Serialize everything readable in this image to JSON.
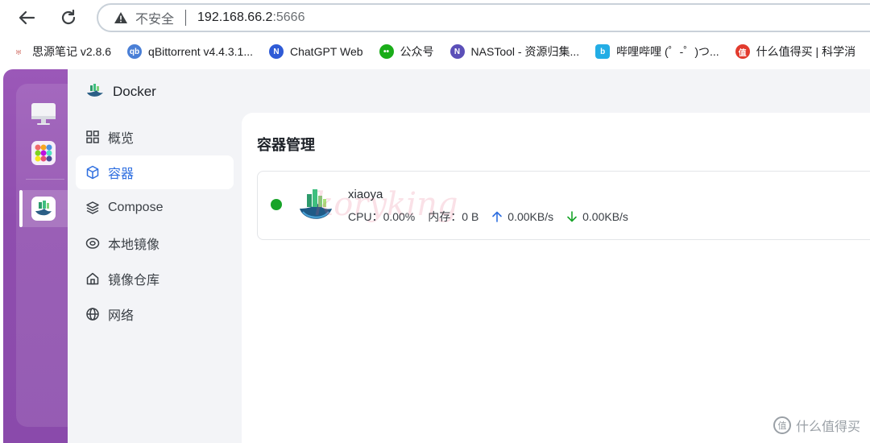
{
  "browser": {
    "security_label": "不安全",
    "url_host": "192.168.66.2",
    "url_port": ":5666"
  },
  "bookmarks": [
    {
      "label": "思源笔记 v2.8.6",
      "icon": "siyuan-icon",
      "color": "#c0392b",
      "glyph": "M"
    },
    {
      "label": "qBittorrent v4.4.3.1...",
      "icon": "qbittorrent-icon",
      "color": "#4a7fd6",
      "glyph": "qb"
    },
    {
      "label": "ChatGPT Web",
      "icon": "chatgpt-icon",
      "color": "#2f5bd6",
      "glyph": "N"
    },
    {
      "label": "公众号",
      "icon": "wechat-icon",
      "color": "#1aad19",
      "glyph": "…"
    },
    {
      "label": "NASTool - 资源归集...",
      "icon": "nastool-icon",
      "color": "#5b4fb8",
      "glyph": "N"
    },
    {
      "label": "哔哩哔哩 (゜-゜)つ...",
      "icon": "bilibili-icon",
      "color": "#23ade5",
      "glyph": "b"
    },
    {
      "label": "什么值得买 | 科学消",
      "icon": "smzdm-icon",
      "color": "#e23b2e",
      "glyph": "值"
    }
  ],
  "app": {
    "title": "Docker",
    "nav": [
      {
        "label": "概览",
        "icon": "grid-icon",
        "active": false
      },
      {
        "label": "容器",
        "icon": "cube-icon",
        "active": true
      },
      {
        "label": "Compose",
        "icon": "layers-icon",
        "active": false
      },
      {
        "label": "本地镜像",
        "icon": "disk-icon",
        "active": false
      },
      {
        "label": "镜像仓库",
        "icon": "home-icon",
        "active": false
      },
      {
        "label": "网络",
        "icon": "globe-icon",
        "active": false
      }
    ]
  },
  "main": {
    "title": "容器管理",
    "containers": [
      {
        "name": "xiaoya",
        "status": "running",
        "status_color": "#17a328",
        "cpu_label": "CPU：",
        "cpu": "0.00%",
        "mem_label": "内存：",
        "mem": "0 B",
        "upload": "0.00KB/s",
        "download": "0.00KB/s"
      }
    ],
    "watermark": "koryking"
  },
  "site_watermark": "什么值得买",
  "colors": {
    "accent": "#2f6fe0",
    "dock": "#9b58b8",
    "running": "#17a328"
  }
}
